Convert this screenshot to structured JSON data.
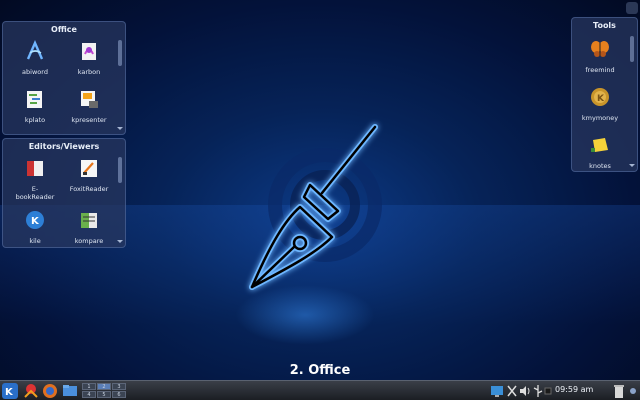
{
  "desktop": {
    "activity_title": "2. Office"
  },
  "widgets": {
    "office": {
      "title": "Office",
      "items": [
        {
          "label": "abiword",
          "icon": "abiword-icon"
        },
        {
          "label": "karbon",
          "icon": "karbon-icon"
        },
        {
          "label": "kplato",
          "icon": "kplato-icon"
        },
        {
          "label": "kpresenter",
          "icon": "kpresenter-icon"
        }
      ]
    },
    "editors": {
      "title": "Editors/Viewers",
      "items": [
        {
          "label": "E-",
          "label2": "bookReader",
          "icon": "ebook-reader-icon"
        },
        {
          "label": "FoxitReader",
          "icon": "foxit-reader-icon"
        },
        {
          "label": "kile",
          "icon": "kile-icon"
        },
        {
          "label": "kompare",
          "icon": "kompare-icon"
        }
      ]
    },
    "tools": {
      "title": "Tools",
      "items": [
        {
          "label": "freemind",
          "icon": "butterfly-icon"
        },
        {
          "label": "kmymoney",
          "icon": "money-icon"
        },
        {
          "label": "knotes",
          "icon": "note-icon"
        }
      ]
    }
  },
  "taskbar": {
    "pager": [
      "1",
      "2",
      "3",
      "4",
      "5",
      "6"
    ],
    "active_desktop": "2",
    "clock": "09:59 am"
  },
  "colors": {
    "accent_blue": "#1e6fe0",
    "pen_glow": "#5aa8ff",
    "taskbar": "#2a2e35"
  }
}
